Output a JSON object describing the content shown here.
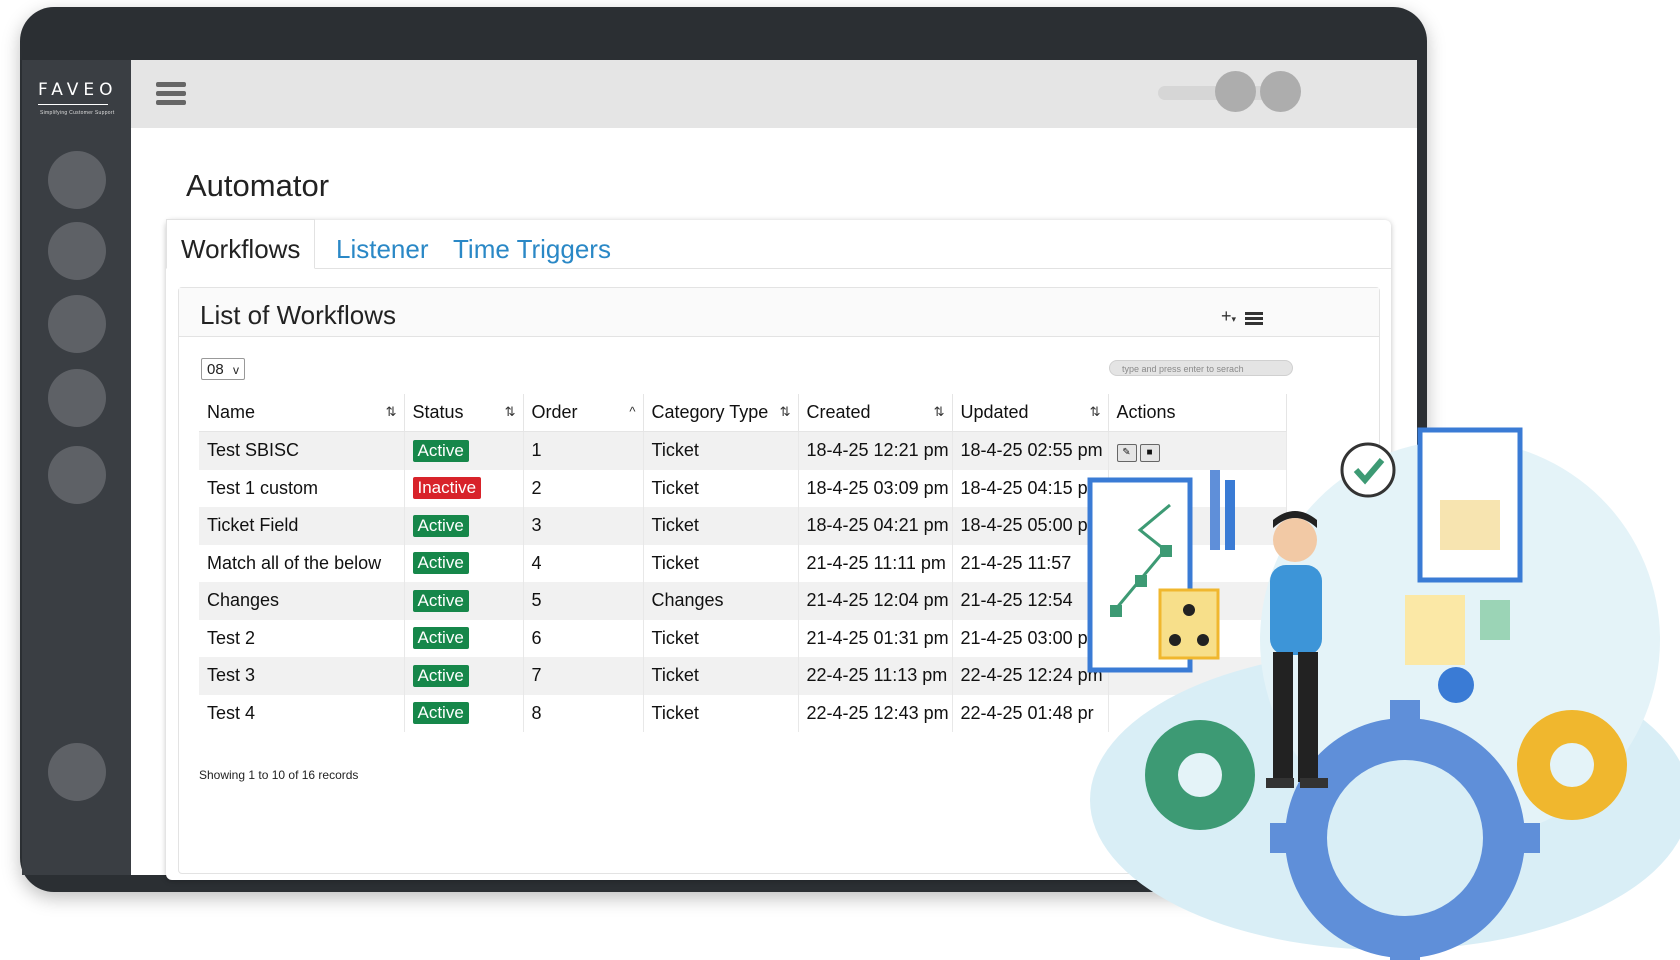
{
  "app": {
    "logo_text": "FAVEO",
    "logo_tagline": "Simplifying Customer Support"
  },
  "page": {
    "title": "Automator"
  },
  "tabs": [
    {
      "label": "Workflows",
      "active": true
    },
    {
      "label": "Listener",
      "active": false
    },
    {
      "label": "Time Triggers",
      "active": false
    }
  ],
  "panel": {
    "title": "List of Workflows",
    "add_icon": "plus-dropdown-icon",
    "menu_icon": "list-icon",
    "page_size": "08",
    "search_placeholder": "type and press enter to serach",
    "footer": "Showing 1 to 10 of 16 records"
  },
  "table": {
    "columns": [
      "Name",
      "Status",
      "Order",
      "Category Type",
      "Created",
      "Updated",
      "Actions"
    ],
    "rows": [
      {
        "name": "Test SBISC",
        "status": "Active",
        "order": "1",
        "category": "Ticket",
        "created": "18-4-25 12:21 pm",
        "updated": "18-4-25 02:55 pm"
      },
      {
        "name": "Test 1 custom",
        "status": "Inactive",
        "order": "2",
        "category": "Ticket",
        "created": "18-4-25 03:09 pm",
        "updated": "18-4-25 04:15 pm"
      },
      {
        "name": "Ticket Field",
        "status": "Active",
        "order": "3",
        "category": "Ticket",
        "created": "18-4-25 04:21 pm",
        "updated": "18-4-25 05:00 p"
      },
      {
        "name": "Match all of the below",
        "status": "Active",
        "order": "4",
        "category": "Ticket",
        "created": "21-4-25 11:11 pm",
        "updated": "21-4-25 11:57"
      },
      {
        "name": "Changes",
        "status": "Active",
        "order": "5",
        "category": "Changes",
        "created": "21-4-25 12:04 pm",
        "updated": "21-4-25 12:54"
      },
      {
        "name": "Test 2",
        "status": "Active",
        "order": "6",
        "category": "Ticket",
        "created": "21-4-25 01:31 pm",
        "updated": "21-4-25 03:00 p"
      },
      {
        "name": "Test 3",
        "status": "Active",
        "order": "7",
        "category": "Ticket",
        "created": "22-4-25 11:13 pm",
        "updated": "22-4-25 12:24 pm"
      },
      {
        "name": "Test 4",
        "status": "Active",
        "order": "8",
        "category": "Ticket",
        "created": "22-4-25 12:43 pm",
        "updated": "22-4-25 01:48 pr"
      }
    ]
  },
  "colors": {
    "active": "#16874a",
    "inactive": "#d8232a",
    "tab_link": "#2a88c6",
    "sidebar": "#3a3e43"
  }
}
